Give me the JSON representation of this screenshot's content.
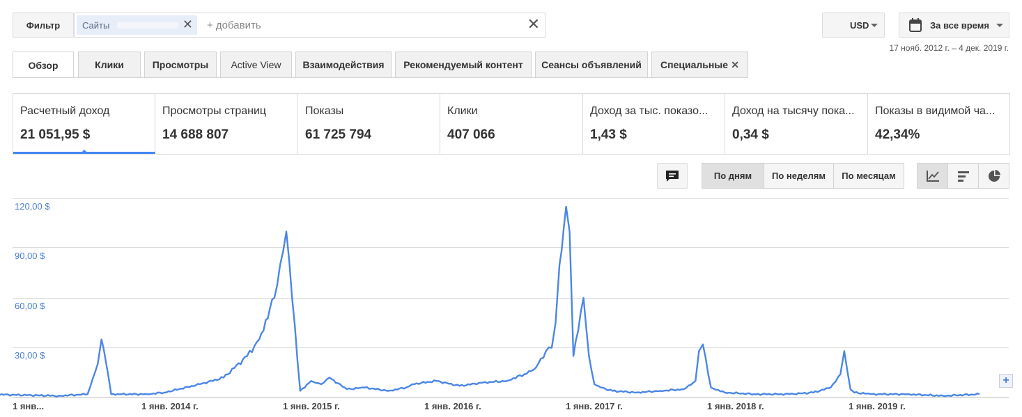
{
  "toolbar": {
    "filter_label": "Фильтр",
    "chip_label": "Сайты",
    "add_placeholder": "+ добавить",
    "currency": "USD",
    "date_range_label": "За все время",
    "date_range_text": "17 нояб. 2012 г. – 4 дек. 2019 г."
  },
  "tabs": [
    {
      "label": "Обзор",
      "active": true
    },
    {
      "label": "Клики"
    },
    {
      "label": "Просмотры"
    },
    {
      "label": "Active View"
    },
    {
      "label": "Взаимодействия"
    },
    {
      "label": "Рекомендуемый контент"
    },
    {
      "label": "Сеансы объявлений"
    },
    {
      "label": "Специальные",
      "closable": true
    }
  ],
  "metrics": [
    {
      "title": "Расчетный доход",
      "value": "21 051,95 $",
      "selected": true
    },
    {
      "title": "Просмотры страниц",
      "value": "14 688 807"
    },
    {
      "title": "Показы",
      "value": "61 725 794"
    },
    {
      "title": "Клики",
      "value": "407 066"
    },
    {
      "title": "Доход за тыс. показо...",
      "value": "1,43 $"
    },
    {
      "title": "Доход на тысячу пока...",
      "value": "0,34 $"
    },
    {
      "title": "Показы в видимой ча...",
      "value": "42,34%"
    }
  ],
  "granularity": {
    "day": "По дням",
    "week": "По неделям",
    "month": "По месяцам",
    "selected": "day"
  },
  "icons": [
    "comment-icon",
    "line-chart-icon",
    "bar-chart-icon",
    "pie-chart-icon",
    "calendar-icon",
    "dropdown-arrow-icon",
    "close-icon",
    "zoom-plus-icon"
  ],
  "colors": {
    "series": "#4a86e8",
    "accent": "#4285f4",
    "axis_label": "#4a7fd4"
  },
  "chart_data": {
    "type": "line",
    "y_tick_labels": [
      "120,00 $",
      "90,00 $",
      "60,00 $",
      "30,00 $"
    ],
    "ylim": [
      0,
      120
    ],
    "x_tick_labels": [
      "1 янв...",
      "1 янв. 2014 г.",
      "1 янв. 2015 г.",
      "1 янв. 2016 г.",
      "1 янв. 2017 г.",
      "1 янв. 2018 г.",
      "1 янв. 2019 г."
    ],
    "grid": true,
    "series": [
      {
        "x": [
          "2012-11-17",
          "2013-06-01",
          "2013-08-15",
          "2013-09-10",
          "2013-09-20",
          "2013-10-01",
          "2013-10-15",
          "2014-01-15",
          "2014-03-01",
          "2014-06-01",
          "2014-08-01",
          "2014-10-01",
          "2014-11-01",
          "2014-12-10",
          "2014-12-25",
          "2015-01-10",
          "2015-01-25",
          "2015-02-15",
          "2015-03-15",
          "2015-04-10",
          "2015-05-01",
          "2015-06-15",
          "2015-08-01",
          "2015-10-01",
          "2015-11-15",
          "2015-12-01",
          "2016-02-01",
          "2016-04-01",
          "2016-06-01",
          "2016-08-01",
          "2016-09-15",
          "2016-10-15",
          "2016-11-10",
          "2016-11-25",
          "2016-12-05",
          "2016-12-15",
          "2017-01-01",
          "2017-01-10",
          "2017-01-20",
          "2017-02-01",
          "2017-02-15",
          "2017-03-01",
          "2017-03-15",
          "2017-04-01",
          "2017-05-01",
          "2017-07-01",
          "2017-09-01",
          "2017-11-01",
          "2017-12-01",
          "2017-12-10",
          "2017-12-20",
          "2018-01-10",
          "2018-02-15",
          "2018-05-01",
          "2018-08-01",
          "2018-10-01",
          "2018-11-15",
          "2018-12-10",
          "2018-12-20",
          "2019-01-05",
          "2019-01-15",
          "2019-03-01",
          "2019-06-01",
          "2019-09-01",
          "2019-12-04"
        ],
        "y": [
          2,
          1,
          2,
          20,
          35,
          22,
          2,
          2,
          3,
          8,
          12,
          25,
          35,
          60,
          80,
          100,
          60,
          4,
          10,
          8,
          12,
          5,
          6,
          4,
          6,
          8,
          10,
          7,
          9,
          10,
          14,
          18,
          28,
          30,
          45,
          80,
          115,
          100,
          25,
          40,
          60,
          25,
          8,
          6,
          4,
          3,
          4,
          5,
          10,
          28,
          32,
          6,
          3,
          2,
          2,
          3,
          6,
          14,
          28,
          5,
          3,
          2,
          2,
          1,
          2
        ]
      }
    ]
  }
}
